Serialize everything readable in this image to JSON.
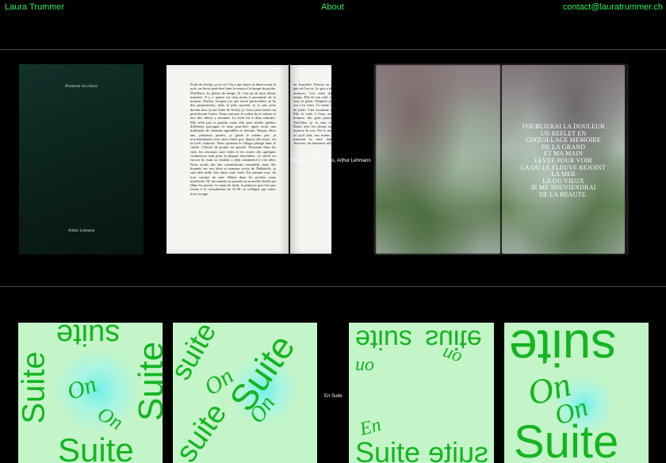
{
  "header": {
    "name": "Laura Trummer",
    "about": "About",
    "contact": "contact@lauratrummer.ch"
  },
  "project1": {
    "caption": "Promener les chiens, Arthur Lehmann",
    "cover_title": "Promener les chiens",
    "cover_author": "Arthur Lehmann",
    "page_left_text": "Forêt du Sochy, ça te va? On a une heure et demi avant la nuit, on devra peut-être faire le retour à la lampe de poche. D'ailleurs. Le plaisir du temps. Si c'est un où nous allons marcher. Il y a quatre ou cinq noms à proximité de la maison. Parfois, lorsque j'ai une envie particulière, je lis des propositions, mais le plus souvent, je te sais assis devant moi. je me fiche de Sochy, je veux juste mettre un pied devant l'autre. Nous ouvrons le coffre de la voiture et une des chiens y montent. La forêt est à deux minutes. Elle n'est pas si grande, mais elle peut rendre publics différents paysages et sans peut-être, après avoir une multitude de chemins agréables se dessine. Depuis deux ans, plusieurs parties, je garde le même pas. je m'acharnement avec mon chien qui, depuis des mois, est la forêt chinoise. Nous quittons le village plongé dans le calme. L'heure de pointe est passée. Personne dans les rues, les terrasses sont vides et les stores des quelques commerces sont pour la plupart descendus. Le soleil est encore là, mais sa chaleur a déjà commencé à s'en aller. Nous avons fait des commissions ensemble, mais des bonnets sur nos têtes et sommes sortis de l'habitacle, je suis allé mille fois dans cette forêt. En somme tout, de jour comme de nuit. Mains dans les poches, nous marchons. M. me montre sa journée au nouvelle chelle qui flâne les passés, le repas de midi, la patience qui n'est pas venue à la consultation de 15:30, sa collègue qui rentre d'un voyage",
    "page_right_text": "en Australie. Parfois on ne sait pas où l'on va. Le gris a déjà des nuances, l'on reste dans le temps. Elle de son côté, souvent sous la pluie, l'hôpital, je les ai vus s'en venir. Le mont un jour de pluie. Une inconnue passée. Elle le volet à l'eau, un jeune homme, des gens partout. sur YouTube, je la suis souvent. Parler avec les chiens est de la mousse le soir. On le monte de ce qu'il faut, nos mains qui se trouvent la terre dans les cheveux, les lanternes urbains."
  },
  "project2": {
    "poem_lines": [
      "J'OUBLIERAI LA DOULEUR",
      "UN REFLET EN",
      "COQUILLAGE MEMOIRE",
      "DE LA GRAND",
      "ET MA MAIN",
      "LEVEE POUR VOIR",
      "LA OU LE FLEUVE REJOINT",
      "LA MER",
      "LA OU VIEUX",
      "JE ME SOUVIENDRAI",
      "DE LA BEAUTE."
    ]
  },
  "project3": {
    "caption": "En Suite",
    "poster_word": "Suite",
    "poster_word_alt": "suite",
    "poster_small": "On",
    "poster_small_alt": "on",
    "poster_en": "En"
  },
  "colors": {
    "background": "#000000",
    "nav_green": "#27f05a",
    "poster_bg": "#c4f5c8",
    "poster_ink": "#14b521",
    "glow": "#6ff0e6"
  }
}
